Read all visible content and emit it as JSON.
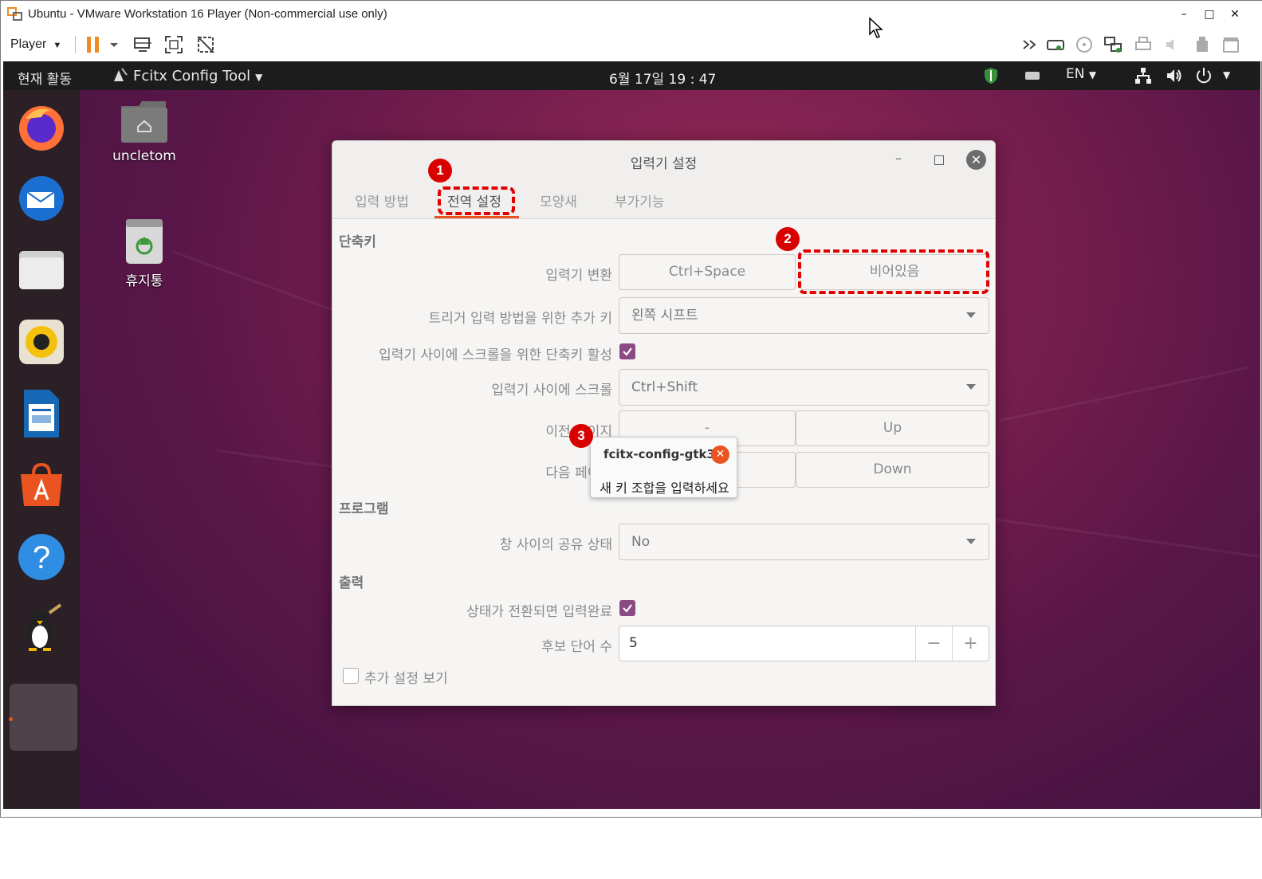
{
  "vmware": {
    "title": "Ubuntu - VMware Workstation 16 Player (Non-commercial use only)",
    "player_menu": "Player",
    "window_controls": {
      "minimize": "–",
      "maximize": "□",
      "close": "✕"
    }
  },
  "ubuntu_topbar": {
    "activities": "현재 활동",
    "app_menu": "Fcitx Config Tool",
    "clock": "6월 17일 19 : 47",
    "input_lang": "EN"
  },
  "desktop": {
    "home_label": "uncletom",
    "trash_label": "휴지통"
  },
  "dock": {
    "apps": [
      "firefox-icon",
      "thunderbird-icon",
      "files-icon",
      "rhythmbox-icon",
      "libreoffice-writer-icon",
      "software-center-icon",
      "help-icon",
      "fcitx-config-icon"
    ]
  },
  "dialog": {
    "title": "입력기 설정",
    "tabs": [
      "입력 방법",
      "전역 설정",
      "모양새",
      "부가기능"
    ],
    "active_tab": "전역 설정",
    "sections": {
      "shortcuts": "단축키",
      "program": "프로그램",
      "output": "출력"
    },
    "rows": {
      "toggle_im": {
        "label": "입력기 변환",
        "key1": "Ctrl+Space",
        "key2": "비어있음"
      },
      "trigger_extra": {
        "label": "트리거 입력 방법을 위한 추가 키",
        "value": "왼쪽 시프트"
      },
      "enable_scroll": {
        "label": "입력기 사이에 스크롤을 위한 단축키 활성"
      },
      "scroll_between": {
        "label": "입력기 사이에 스크롤",
        "value": "Ctrl+Shift"
      },
      "prev_page": {
        "label": "이전 페이지",
        "key1": "-",
        "key2": "Up"
      },
      "next_page": {
        "label": "다음 페이지",
        "key2": "Down"
      },
      "share_state": {
        "label": "창 사이의 공유 상태",
        "value": "No"
      },
      "commit_on_switch": {
        "label": "상태가 전환되면 입력완료"
      },
      "candidate_count": {
        "label": "후보 단어 수",
        "value": "5",
        "minus": "−",
        "plus": "+"
      }
    },
    "show_advanced": "추가 설정 보기"
  },
  "popup": {
    "title": "fcitx-config-gtk3",
    "message": "새 키 조합을 입력하세요"
  },
  "annotations": [
    "1",
    "2",
    "3"
  ],
  "colors": {
    "annotation_red": "#d90000",
    "ubuntu_orange": "#e95420",
    "checkbox_purple": "#8a4a82",
    "vm_pause_orange": "#f08a24"
  }
}
